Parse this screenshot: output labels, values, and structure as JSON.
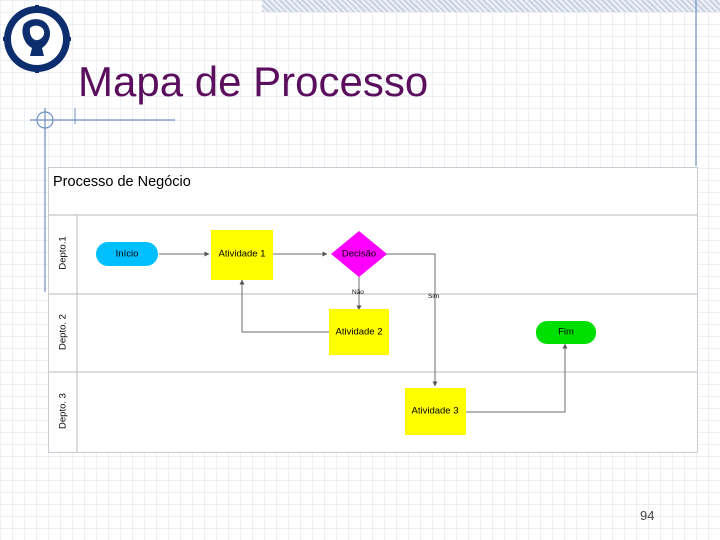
{
  "slide": {
    "title": "Mapa de Processo",
    "page_number": "94"
  },
  "diagram": {
    "title": "Processo de Negócio",
    "lanes": [
      "Depto.1",
      "Depto. 2",
      "Depto. 3"
    ],
    "nodes": {
      "start": "Início",
      "activity1": "Atividade 1",
      "decision": "Decisão",
      "activity2": "Atividade 2",
      "activity3": "Atividade 3",
      "end": "Fim"
    },
    "branches": {
      "no": "Não",
      "yes": "Sim"
    }
  },
  "colors": {
    "title": "#5b0e5e",
    "start_end": "#00bfff",
    "end": "#00e000",
    "activity": "#ffff00",
    "decision": "#ff00ff",
    "connector": "#6e6e6e",
    "lane_line": "#b9b9bd"
  },
  "logo": {
    "icon": "university-seal-icon"
  }
}
